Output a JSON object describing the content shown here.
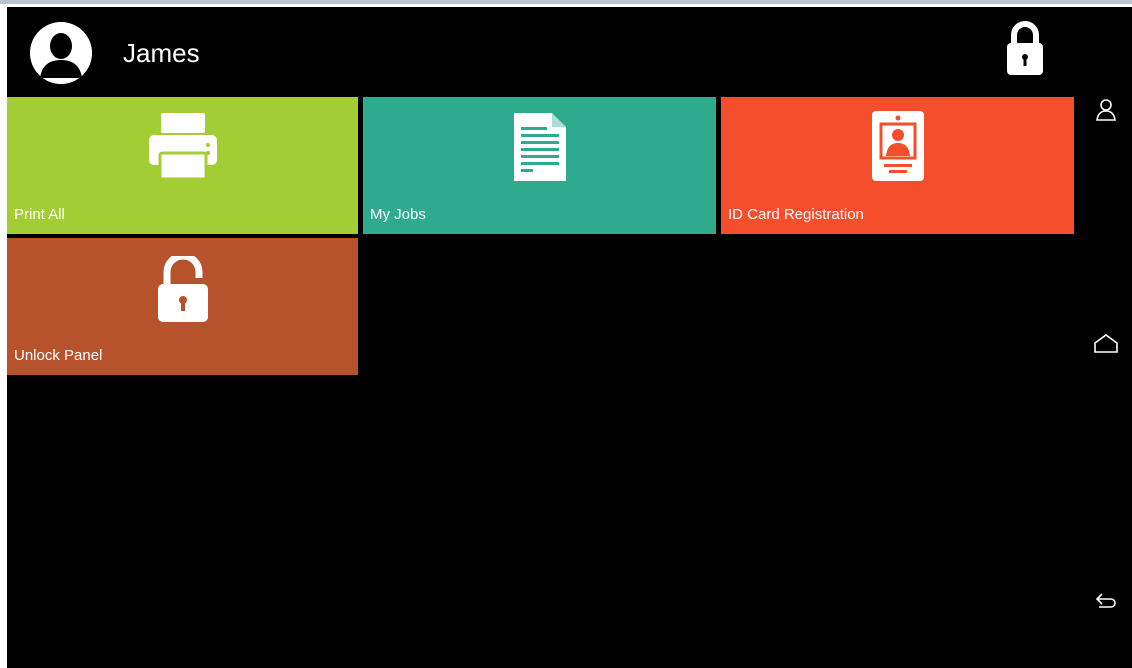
{
  "header": {
    "user_name": "James",
    "avatar_icon": "user-avatar-icon",
    "lock_icon": "lock-icon"
  },
  "tiles": [
    {
      "label": "Print All",
      "icon": "printer-icon",
      "color": "#a2cd34"
    },
    {
      "label": "My Jobs",
      "icon": "document-icon",
      "color": "#2eaa8f"
    },
    {
      "label": "ID Card Registration",
      "icon": "id-card-icon",
      "color": "#f54e2d"
    },
    {
      "label": "Unlock Panel",
      "icon": "unlock-icon",
      "color": "#b6532c"
    }
  ],
  "navbar": {
    "items": [
      "user-outline-icon",
      "home-outline-icon",
      "back-arrow-icon"
    ]
  },
  "colors": {
    "background": "#000000",
    "text": "#ffffff"
  }
}
